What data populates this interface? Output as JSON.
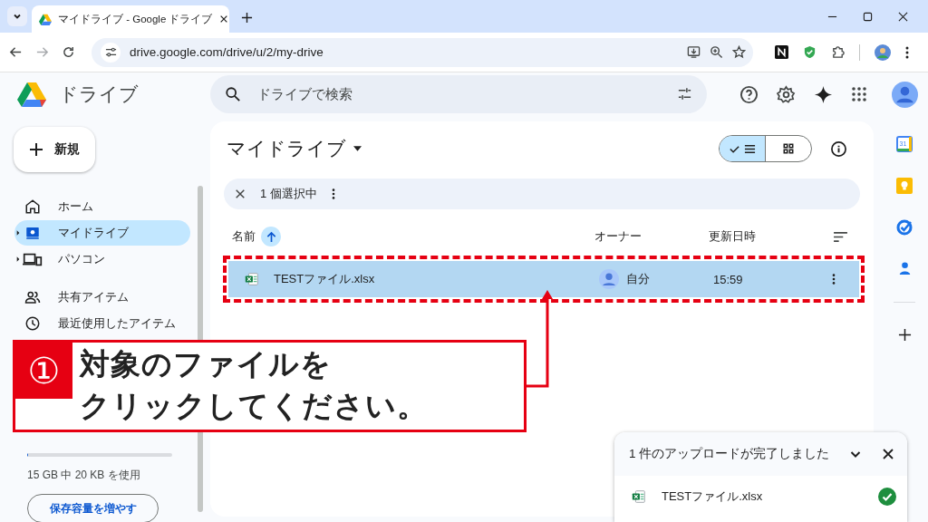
{
  "browser": {
    "tab_title": "マイドライブ - Google ドライブ",
    "url": "drive.google.com/drive/u/2/my-drive"
  },
  "app": {
    "name": "ドライブ",
    "search": {
      "placeholder": "ドライブで検索"
    }
  },
  "new_button": "新規",
  "sidebar": {
    "groups": [
      [
        {
          "label": "ホーム",
          "selected": false,
          "expandable": false
        },
        {
          "label": "マイドライブ",
          "selected": true,
          "expandable": true
        },
        {
          "label": "パソコン",
          "selected": false,
          "expandable": true
        }
      ],
      [
        {
          "label": "共有アイテム",
          "selected": false,
          "expandable": false
        },
        {
          "label": "最近使用したアイテム",
          "selected": false,
          "expandable": false
        }
      ]
    ],
    "storage": {
      "level": 0.005,
      "text": "15 GB 中 20 KB を使用",
      "button": "保存容量を増やす"
    }
  },
  "main": {
    "title": "マイドライブ",
    "view_options": [
      {
        "kind": "list",
        "selected": true
      },
      {
        "kind": "grid",
        "selected": false
      }
    ],
    "selection_bar": {
      "text": "1 個選択中"
    },
    "columns": [
      "名前",
      "オーナー",
      "更新日時"
    ],
    "rows": [
      {
        "name": "TESTファイル.xlsx",
        "owner": "自分",
        "modified": "15:59",
        "selected": true
      }
    ]
  },
  "rail": {
    "calendar_day": "31"
  },
  "upload": {
    "title": "1 件のアップロードが完了しました",
    "items": [
      {
        "name": "TESTファイル.xlsx",
        "done": true
      }
    ]
  },
  "callout": {
    "number": "①",
    "lines": [
      "対象のファイルを",
      "クリックしてください。"
    ]
  }
}
